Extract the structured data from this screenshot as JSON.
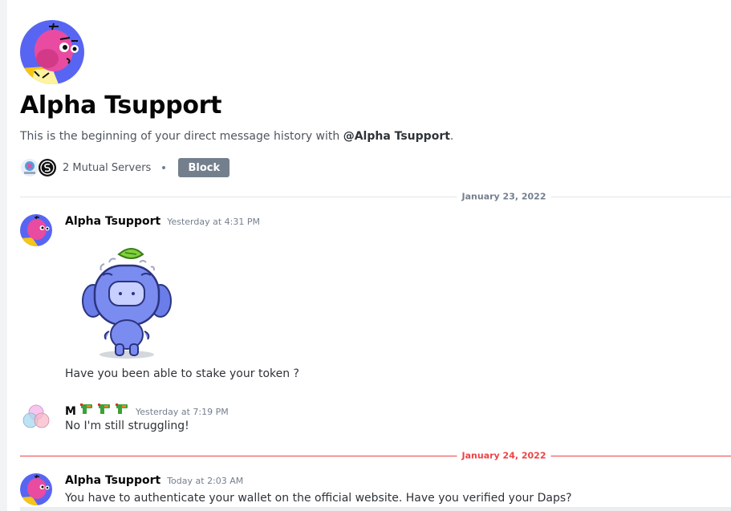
{
  "dm": {
    "title": "Alpha Tsupport",
    "intro_prefix": "This is the beginning of your direct message history with ",
    "intro_mention": "@Alpha Tsupport",
    "intro_suffix": ".",
    "mutual_servers": "2 Mutual Servers",
    "block_label": "Block"
  },
  "dividers": [
    {
      "label": "January 23, 2022",
      "is_new": false
    },
    {
      "label": "January 24, 2022",
      "is_new": true
    }
  ],
  "messages": [
    {
      "author": "Alpha Tsupport",
      "timestamp": "Yesterday at 4:31 PM",
      "text": "Have you been able to stake your token ?",
      "sticker": "wumpus-sticker"
    },
    {
      "author": "M",
      "timestamp": "Yesterday at 7:19 PM",
      "text": "No I'm still struggling!",
      "badges": [
        "gun-emoji",
        "gun-emoji",
        "gun-emoji"
      ]
    },
    {
      "author": "Alpha Tsupport",
      "timestamp": "Today at 2:03 AM",
      "text": "You have to authenticate your wallet on the official website. Have you verified your Daps?"
    }
  ],
  "colors": {
    "new_divider": "#ed4245",
    "block_button": "#747f8d",
    "avatar_bg": "#5865f2"
  }
}
